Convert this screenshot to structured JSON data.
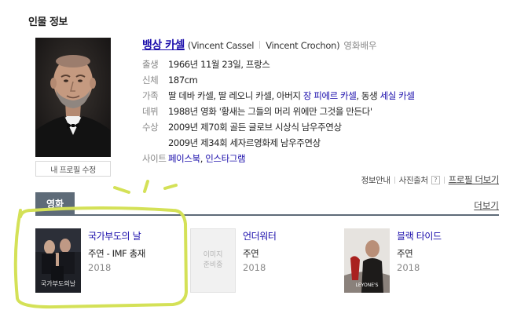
{
  "section_title": "인물 정보",
  "profile": {
    "name": "뱅상 카셀",
    "english_name": "(Vincent Cassel",
    "real_name": "Vincent Crochon)",
    "occupation": "영화배우",
    "edit_button": "내 프로필 수정"
  },
  "info": {
    "birth": {
      "label": "출생",
      "value": "1966년 11월 23일, 프랑스"
    },
    "body": {
      "label": "신체",
      "value": "187cm"
    },
    "family": {
      "label": "가족",
      "text1": "딸 데바 카셀, 딸 레오니 카셀, 아버지 ",
      "link1": "장 피에르 카셀",
      "text2": ", 동생 ",
      "link2": "세실 카셀"
    },
    "debut": {
      "label": "데뷔",
      "value": "1988년 영화 '황새는 그들의 머리 위에만 그것을 만든다'"
    },
    "awards": {
      "label": "수상",
      "line1": "2009년 제70회 골든 글로브 시상식 남우주연상",
      "line2": "2009년 제34회 세자르영화제 남우주연상"
    },
    "sites": {
      "label": "사이트",
      "link1": "페이스북",
      "comma": ", ",
      "link2": "인스타그램"
    }
  },
  "links_bar": {
    "info_guide": "정보안내",
    "photo_source": "사진출처",
    "q_icon": "?",
    "more_profile": "프로필 더보기"
  },
  "movies_section": {
    "tab_label": "영화",
    "more_label": "더보기",
    "items": [
      {
        "title": "국가부도의 날",
        "role": "주연 - IMF 총재",
        "year": "2018",
        "poster": "poster-image"
      },
      {
        "title": "언더워터",
        "role": "주연",
        "year": "2018",
        "poster_line1": "이미지",
        "poster_line2": "준비중"
      },
      {
        "title": "블랙 타이드",
        "role": "주연",
        "year": "2018",
        "poster": "poster-image"
      }
    ]
  },
  "colors": {
    "link": "#1a0dab",
    "tab": "#5e6b78",
    "annotation": "#d4e157"
  }
}
